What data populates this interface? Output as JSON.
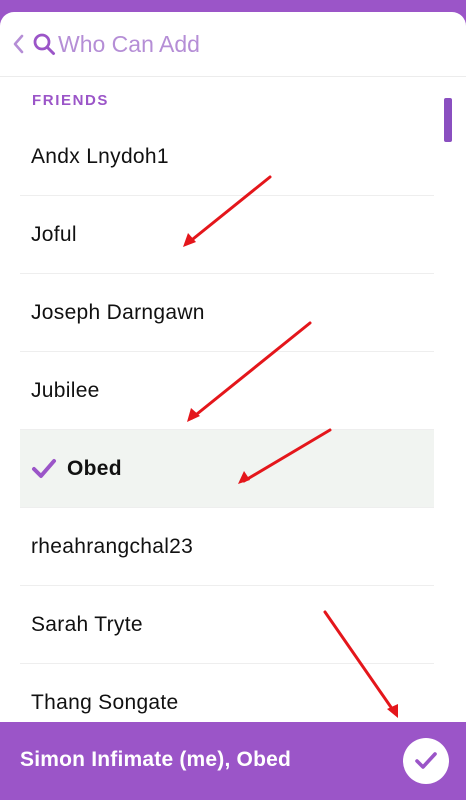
{
  "header": {
    "back_icon": "chevron-left-icon",
    "search_icon": "search-icon",
    "search_placeholder": "Who Can Add",
    "search_value": ""
  },
  "section": {
    "label": "FRIENDS"
  },
  "friends": [
    {
      "name": "Andx Lnydoh1",
      "selected": false
    },
    {
      "name": "Joful",
      "selected": false
    },
    {
      "name": "Joseph Darngawn",
      "selected": false
    },
    {
      "name": "Jubilee",
      "selected": false
    },
    {
      "name": "Obed",
      "selected": true
    },
    {
      "name": "rheahrangchal23",
      "selected": false
    },
    {
      "name": "Sarah Tryte",
      "selected": false
    },
    {
      "name": "Thang Songate",
      "selected": false
    }
  ],
  "footer": {
    "selected_text": "Simon Infimate (me), Obed",
    "confirm_icon": "checkmark-icon"
  },
  "colors": {
    "accent": "#9b55c8",
    "selected_row_bg": "#f1f4f1",
    "annotation_arrow": "#e4161b"
  }
}
